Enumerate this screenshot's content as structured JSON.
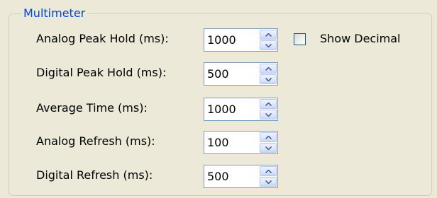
{
  "group": {
    "title": "Multimeter"
  },
  "rows": [
    {
      "label": "Analog Peak Hold (ms):",
      "value": "1000"
    },
    {
      "label": "Digital Peak Hold (ms):",
      "value": "500"
    },
    {
      "label": "Average Time (ms):",
      "value": "1000"
    },
    {
      "label": "Analog Refresh (ms):",
      "value": "100"
    },
    {
      "label": "Digital Refresh (ms):",
      "value": "500"
    }
  ],
  "options": {
    "show_decimal": {
      "label": "Show Decimal",
      "checked": false
    }
  },
  "icons": {
    "spin_up": "chevron-up-icon",
    "spin_down": "chevron-down-icon"
  },
  "colors": {
    "group_title": "#0046d5",
    "panel_background": "#ece9d8",
    "input_border": "#7f9db9",
    "checkbox_border": "#1c5180"
  }
}
